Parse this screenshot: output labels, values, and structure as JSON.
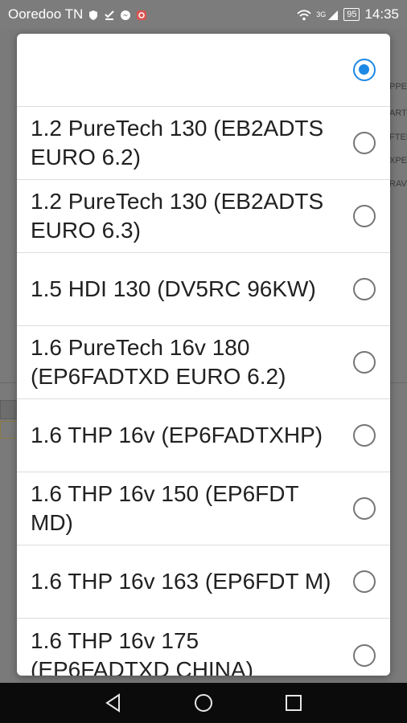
{
  "status_bar": {
    "carrier": "Ooredoo TN",
    "signal_label": "3G",
    "battery": "95",
    "time": "14:35"
  },
  "background_fragments": [
    "PPE",
    "ART",
    "FTEI",
    "XPE",
    "RAV"
  ],
  "options": [
    {
      "label": "",
      "selected": true
    },
    {
      "label": "1.2 PureTech 130 (EB2ADTS EURO 6.2)",
      "selected": false
    },
    {
      "label": "1.2 PureTech 130 (EB2ADTS EURO 6.3)",
      "selected": false
    },
    {
      "label": "1.5 HDI 130 (DV5RC 96KW)",
      "selected": false
    },
    {
      "label": "1.6 PureTech 16v 180 (EP6FADTXD EURO 6.2)",
      "selected": false
    },
    {
      "label": "1.6 THP 16v (EP6FADTXHP)",
      "selected": false
    },
    {
      "label": "1.6 THP 16v 150 (EP6FDT MD)",
      "selected": false
    },
    {
      "label": "1.6 THP 16v 163 (EP6FDT M)",
      "selected": false
    },
    {
      "label": "1.6 THP 16v 175 (EP6FADTXD CHINA)",
      "selected": false
    }
  ],
  "colors": {
    "accent": "#1e88e5",
    "radio_off": "#757575",
    "scrim": "#7a7a7a",
    "navbar": "#0b0b0b"
  },
  "icons": {
    "nav_back": "back-triangle-icon",
    "nav_home": "home-circle-icon",
    "nav_recents": "recents-square-icon"
  }
}
